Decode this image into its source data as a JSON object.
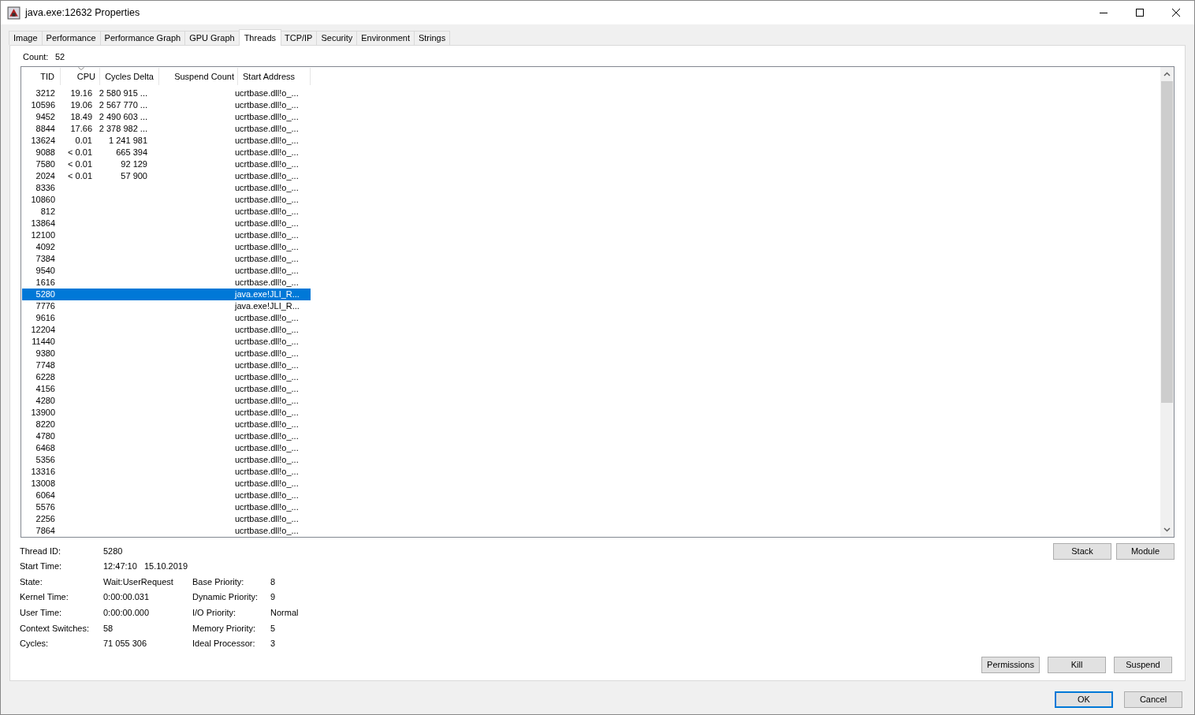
{
  "window": {
    "title": "java.exe:12632 Properties"
  },
  "tabs": [
    {
      "label": "Image",
      "selected": false
    },
    {
      "label": "Performance",
      "selected": false
    },
    {
      "label": "Performance Graph",
      "selected": false
    },
    {
      "label": "GPU Graph",
      "selected": false
    },
    {
      "label": "Threads",
      "selected": true
    },
    {
      "label": "TCP/IP",
      "selected": false
    },
    {
      "label": "Security",
      "selected": false
    },
    {
      "label": "Environment",
      "selected": false
    },
    {
      "label": "Strings",
      "selected": false
    }
  ],
  "count": {
    "label": "Count:",
    "value": "52"
  },
  "table": {
    "columns": [
      {
        "label": "TID",
        "sorted": false
      },
      {
        "label": "CPU",
        "sorted": true
      },
      {
        "label": "Cycles Delta",
        "sorted": false
      },
      {
        "label": "Suspend Count",
        "sorted": false
      },
      {
        "label": "Start Address",
        "sorted": false
      }
    ],
    "rows": [
      {
        "tid": "3212",
        "cpu": "19.16",
        "cycles": "2 580 915 ...",
        "start": "ucrtbase.dll!o_...",
        "selected": false
      },
      {
        "tid": "10596",
        "cpu": "19.06",
        "cycles": "2 567 770 ...",
        "start": "ucrtbase.dll!o_...",
        "selected": false
      },
      {
        "tid": "9452",
        "cpu": "18.49",
        "cycles": "2 490 603 ...",
        "start": "ucrtbase.dll!o_...",
        "selected": false
      },
      {
        "tid": "8844",
        "cpu": "17.66",
        "cycles": "2 378 982 ...",
        "start": "ucrtbase.dll!o_...",
        "selected": false
      },
      {
        "tid": "13624",
        "cpu": "0.01",
        "cycles": "1 241 981",
        "start": "ucrtbase.dll!o_...",
        "selected": false
      },
      {
        "tid": "9088",
        "cpu": "< 0.01",
        "cycles": "665 394",
        "start": "ucrtbase.dll!o_...",
        "selected": false
      },
      {
        "tid": "7580",
        "cpu": "< 0.01",
        "cycles": "92 129",
        "start": "ucrtbase.dll!o_...",
        "selected": false
      },
      {
        "tid": "2024",
        "cpu": "< 0.01",
        "cycles": "57 900",
        "start": "ucrtbase.dll!o_...",
        "selected": false
      },
      {
        "tid": "8336",
        "start": "ucrtbase.dll!o_...",
        "selected": false
      },
      {
        "tid": "10860",
        "start": "ucrtbase.dll!o_...",
        "selected": false
      },
      {
        "tid": "812",
        "start": "ucrtbase.dll!o_...",
        "selected": false
      },
      {
        "tid": "13864",
        "start": "ucrtbase.dll!o_...",
        "selected": false
      },
      {
        "tid": "12100",
        "start": "ucrtbase.dll!o_...",
        "selected": false
      },
      {
        "tid": "4092",
        "start": "ucrtbase.dll!o_...",
        "selected": false
      },
      {
        "tid": "7384",
        "start": "ucrtbase.dll!o_...",
        "selected": false
      },
      {
        "tid": "9540",
        "start": "ucrtbase.dll!o_...",
        "selected": false
      },
      {
        "tid": "1616",
        "start": "ucrtbase.dll!o_...",
        "selected": false
      },
      {
        "tid": "5280",
        "start": "java.exe!JLI_R...",
        "selected": true
      },
      {
        "tid": "7776",
        "start": "java.exe!JLI_R...",
        "selected": false
      },
      {
        "tid": "9616",
        "start": "ucrtbase.dll!o_...",
        "selected": false
      },
      {
        "tid": "12204",
        "start": "ucrtbase.dll!o_...",
        "selected": false
      },
      {
        "tid": "11440",
        "start": "ucrtbase.dll!o_...",
        "selected": false
      },
      {
        "tid": "9380",
        "start": "ucrtbase.dll!o_...",
        "selected": false
      },
      {
        "tid": "7748",
        "start": "ucrtbase.dll!o_...",
        "selected": false
      },
      {
        "tid": "6228",
        "start": "ucrtbase.dll!o_...",
        "selected": false
      },
      {
        "tid": "4156",
        "start": "ucrtbase.dll!o_...",
        "selected": false
      },
      {
        "tid": "4280",
        "start": "ucrtbase.dll!o_...",
        "selected": false
      },
      {
        "tid": "13900",
        "start": "ucrtbase.dll!o_...",
        "selected": false
      },
      {
        "tid": "8220",
        "start": "ucrtbase.dll!o_...",
        "selected": false
      },
      {
        "tid": "4780",
        "start": "ucrtbase.dll!o_...",
        "selected": false
      },
      {
        "tid": "6468",
        "start": "ucrtbase.dll!o_...",
        "selected": false
      },
      {
        "tid": "5356",
        "start": "ucrtbase.dll!o_...",
        "selected": false
      },
      {
        "tid": "13316",
        "start": "ucrtbase.dll!o_...",
        "selected": false
      },
      {
        "tid": "13008",
        "start": "ucrtbase.dll!o_...",
        "selected": false
      },
      {
        "tid": "6064",
        "start": "ucrtbase.dll!o_...",
        "selected": false
      },
      {
        "tid": "5576",
        "start": "ucrtbase.dll!o_...",
        "selected": false
      },
      {
        "tid": "2256",
        "start": "ucrtbase.dll!o_...",
        "selected": false
      },
      {
        "tid": "7864",
        "start": "ucrtbase.dll!o_...",
        "selected": false
      }
    ]
  },
  "details": {
    "left": [
      {
        "label": "Thread ID:",
        "value": "5280"
      },
      {
        "label": "Start Time:",
        "value": "12:47:10   15.10.2019"
      },
      {
        "label": "State:",
        "value": "Wait:UserRequest"
      },
      {
        "label": "Kernel Time:",
        "value": "0:00:00.031"
      },
      {
        "label": "User Time:",
        "value": "0:00:00.000"
      },
      {
        "label": "Context Switches:",
        "value": "58"
      },
      {
        "label": "Cycles:",
        "value": "71 055 306"
      }
    ],
    "right": [
      {
        "label": "Base Priority:",
        "value": "8"
      },
      {
        "label": "Dynamic Priority:",
        "value": "9"
      },
      {
        "label": "I/O Priority:",
        "value": "Normal"
      },
      {
        "label": "Memory Priority:",
        "value": "5"
      },
      {
        "label": "Ideal Processor:",
        "value": "3"
      }
    ]
  },
  "thread_buttons": [
    "Stack",
    "Module"
  ],
  "action_buttons": [
    "Permissions",
    "Kill",
    "Suspend"
  ],
  "dialog_buttons": [
    {
      "label": "OK",
      "default": true
    },
    {
      "label": "Cancel",
      "default": false
    }
  ]
}
